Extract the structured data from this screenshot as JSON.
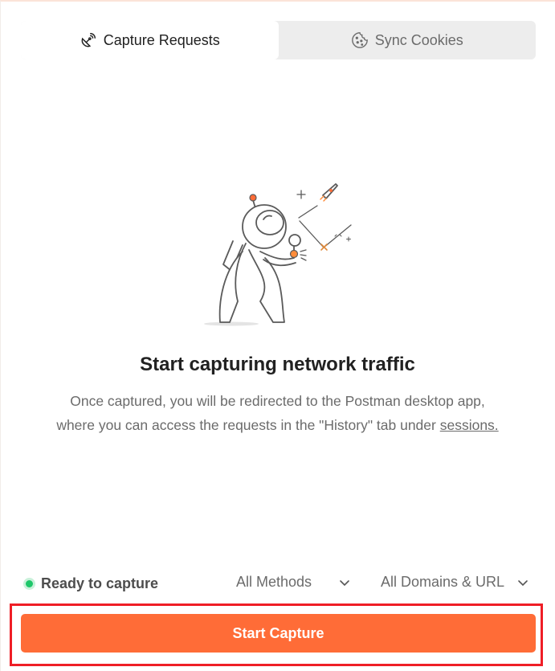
{
  "tabs": [
    {
      "label": "Capture Requests",
      "icon": "satellite-icon",
      "active": true
    },
    {
      "label": "Sync Cookies",
      "icon": "cookie-icon",
      "active": false
    }
  ],
  "empty_state": {
    "heading": "Start capturing network traffic",
    "description_line1": "Once captured, you will be redirected to the Postman desktop app,",
    "description_line2_prefix": "where you can access the requests in the \"History\" tab under ",
    "description_link": "sessions."
  },
  "status": {
    "label": "Ready to capture",
    "color": "#1ec76a"
  },
  "filters": {
    "methods": "All Methods",
    "domains": "All Domains & URL"
  },
  "actions": {
    "start_capture": "Start Capture"
  },
  "colors": {
    "accent": "#ff6c37",
    "highlight": "#ef1e26"
  }
}
